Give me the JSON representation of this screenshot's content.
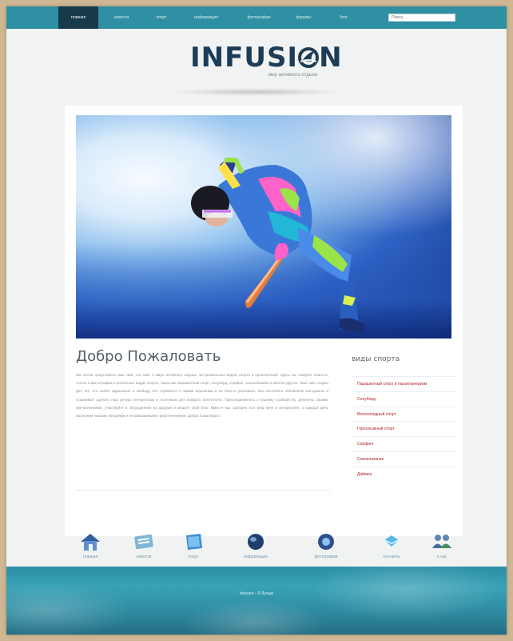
{
  "nav": {
    "items": [
      {
        "label": "главная",
        "active": true
      },
      {
        "label": "новости"
      },
      {
        "label": "спорт"
      },
      {
        "label": "информация"
      },
      {
        "label": "фотографии"
      },
      {
        "label": "форумы"
      },
      {
        "label": "блог"
      }
    ],
    "search_placeholder": "Поиск..."
  },
  "logo": {
    "text_left": "INFUSI",
    "text_right": "N",
    "tagline": "мир активного отдыха"
  },
  "main": {
    "heading": "Добро Пожаловать",
    "paragraph": "Мы хотим представить вам сайт, это сайт о мире активного отдыха, экстремальных видов спорта и приключений. Здесь вы найдете новости, статьи и фотографии о различных видах спорта, таких как парашютный спорт, сноуборд, серфинг, скалолазание и многое другое. Наш сайт создан для тех, кто любит адреналин и свободу, кто стремится к новым вершинам и не боится рисковать. Мы постоянно обновляем материалы и стараемся сделать наш ресурс интересным и полезным для каждого посетителя. Присоединяйтесь к нашему сообществу, делитесь своими впечатлениями, участвуйте в обсуждениях на форуме и ведите свой блог. Вместе мы сделаем этот мир ярче и интереснее, а каждый день наполним новыми эмоциями и незабываемыми приключениями. Добро пожаловать!"
  },
  "sidebar": {
    "title": "виды спорта",
    "items": [
      "Парашютный спорт и парапланеризм",
      "Сноуборд",
      "Велосипедный спорт",
      "Горнолыжный спорт",
      "Серфинг",
      "Скалолазание",
      "Дайвинг"
    ]
  },
  "iconbar": {
    "items": [
      {
        "label": "главная",
        "icon": "house-icon"
      },
      {
        "label": "новости",
        "icon": "newspaper-icon"
      },
      {
        "label": "спорт",
        "icon": "folder-icon"
      },
      {
        "label": "информация",
        "icon": "globe-icon"
      },
      {
        "label": "фотографии",
        "icon": "camera-icon"
      },
      {
        "label": "контакты",
        "icon": "envelope-icon"
      },
      {
        "label": "о нас",
        "icon": "people-icon"
      }
    ]
  },
  "footer": {
    "copyright": "Infusion - © Лучше"
  },
  "colors": {
    "nav_bg": "#2f8fa3",
    "nav_active": "#173a4a",
    "logo": "#1c3c57",
    "sidebar_link": "#b0262c",
    "footer": "#2b8fa5"
  }
}
